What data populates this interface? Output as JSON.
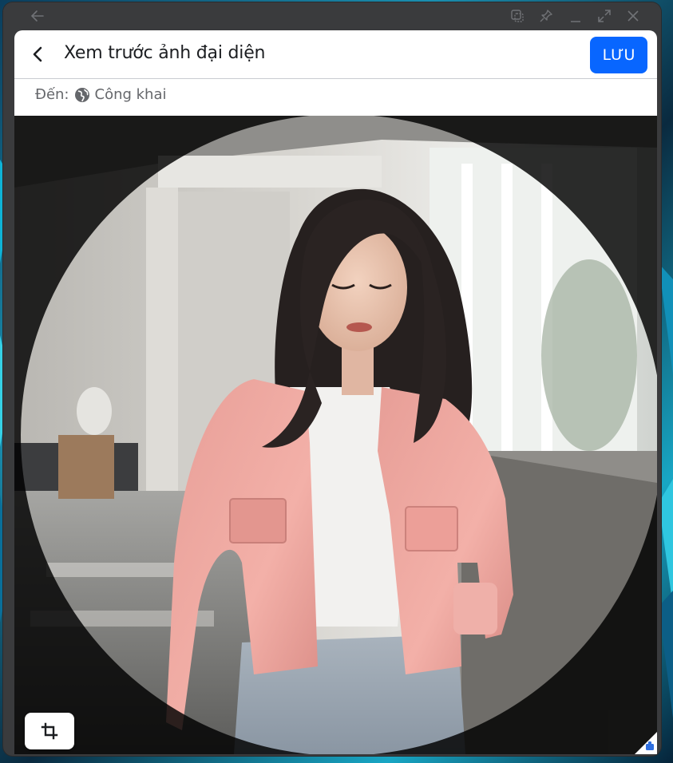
{
  "window": {
    "titlebar_buttons": [
      "back-arrow-icon",
      "picture-in-picture-icon",
      "pin-icon",
      "minimize-icon",
      "maximize-icon",
      "close-icon"
    ]
  },
  "dialog": {
    "title": "Xem trước ảnh đại diện",
    "save_label": "LƯU",
    "audience_prefix": "Đến:",
    "audience_value": "Công khai"
  },
  "preview": {
    "crop_icon": "crop-icon",
    "shape": "circle"
  },
  "colors": {
    "accent": "#0866ff",
    "title_text": "#1c1e21",
    "muted_text": "#65676b",
    "window_frame": "#3a3b3d"
  }
}
